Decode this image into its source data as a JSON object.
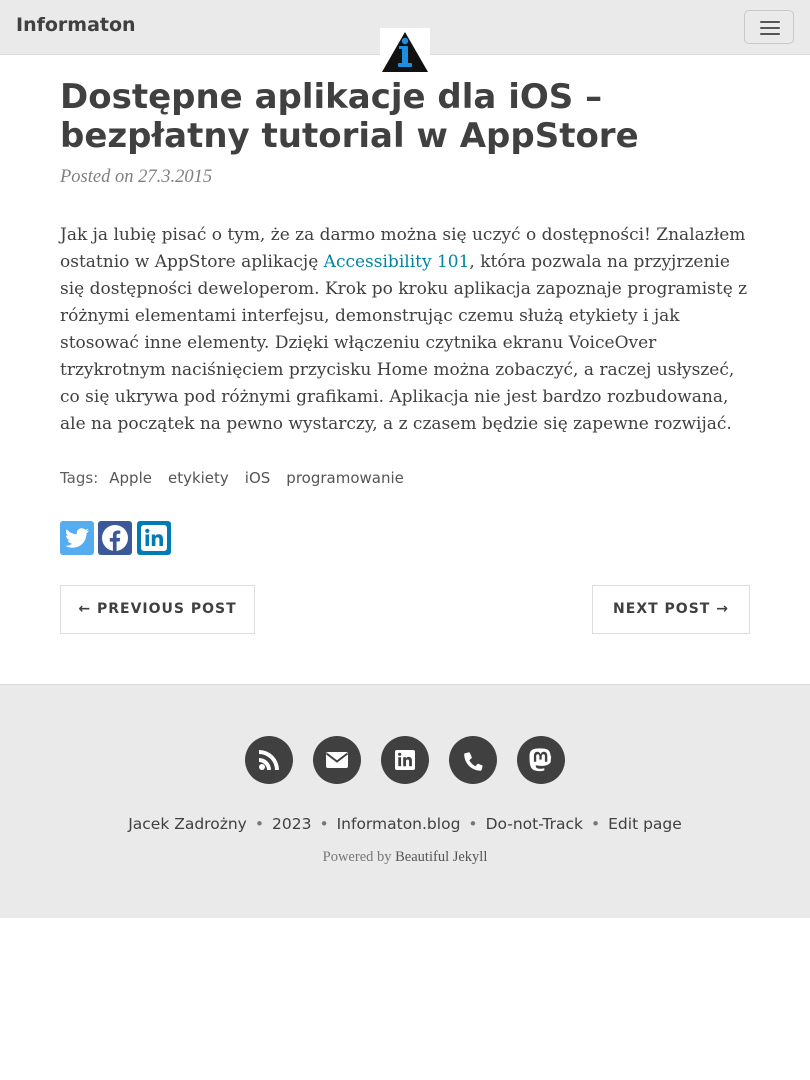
{
  "navbar": {
    "brand": "Informaton",
    "logo_icon": "info-triangle-logo",
    "menu_icon": "hamburger-icon"
  },
  "post": {
    "title": "Dostępne aplikacje dla iOS – bezpłatny tutorial w AppStore",
    "meta": "Posted on 27.3.2015",
    "body_before_link": "Jak ja lubię pisać o tym, że za darmo można się uczyć o dostępności! Znalazłem ostatnio w AppStore aplikację ",
    "link_text": "Accessibility 101",
    "body_after_link": ", która pozwala na przyjrzenie się dostępności deweloperom. Krok po kroku aplikacja zapoznaje programistę z różnymi elementami interfejsu, demonstrując czemu służą etykiety i jak stosować inne elementy. Dzięki włączeniu czytnika ekranu VoiceOver trzykrotnym naciśnięciem przycisku Home można zobaczyć, a raczej usłyszeć, co się ukrywa pod różnymi grafikami. Aplikacja nie jest bardzo rozbudowana, ale na początek na pewno wystarczy, a z czasem będzie się zapewne rozwijać.",
    "link_color": "#0085a1"
  },
  "tags": {
    "label": "Tags:",
    "items": [
      "Apple",
      "etykiety",
      "iOS",
      "programowanie"
    ]
  },
  "share": {
    "items": [
      {
        "icon": "twitter-icon",
        "color": "#55acee"
      },
      {
        "icon": "facebook-icon",
        "color": "#3b5998"
      },
      {
        "icon": "linkedin-icon",
        "color": "#007bb5"
      }
    ]
  },
  "pager": {
    "previous": "← PREVIOUS POST",
    "next": "NEXT POST →"
  },
  "footer": {
    "social_icons": [
      "rss-icon",
      "envelope-icon",
      "linkedin-icon",
      "phone-icon",
      "mastodon-icon"
    ],
    "author": "Jacek Zadrożny",
    "year": "2023",
    "site": "Informaton.blog",
    "dnt": "Do-not-Track",
    "edit": "Edit page",
    "separator": "•",
    "powered_prefix": "Powered by",
    "powered_link": "Beautiful Jekyll"
  }
}
